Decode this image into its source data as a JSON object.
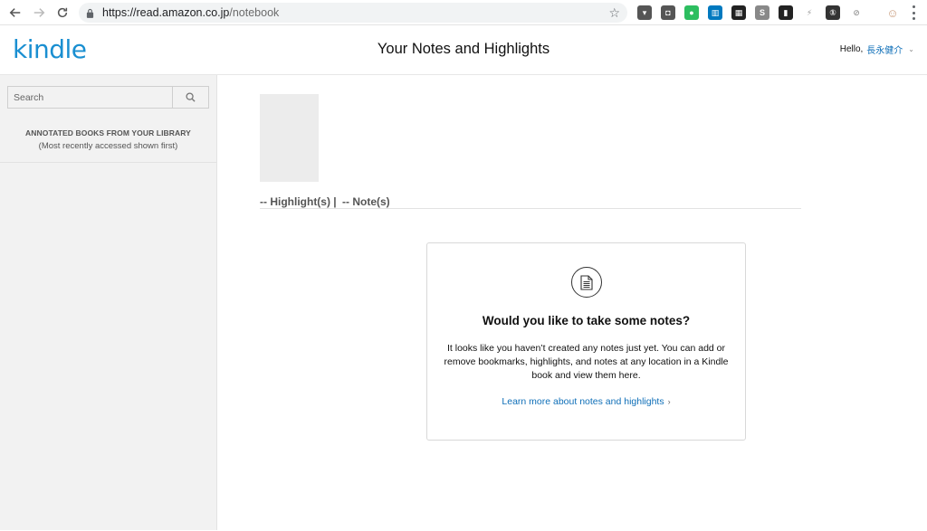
{
  "browser": {
    "url_host": "https://read.amazon.co.jp",
    "url_path": "/notebook",
    "extensions": [
      {
        "name": "pocket-icon",
        "color": "#555555",
        "glyph": "▾"
      },
      {
        "name": "shield-extension-icon",
        "color": "#555555",
        "glyph": "◘"
      },
      {
        "name": "evernote-icon",
        "color": "#2dbe60",
        "glyph": "●"
      },
      {
        "name": "trello-icon",
        "color": "#0079bf",
        "glyph": "▥"
      },
      {
        "name": "calendar-extension-icon",
        "color": "#222222",
        "glyph": "▦"
      },
      {
        "name": "s-extension-icon",
        "color": "#888888",
        "glyph": "S"
      },
      {
        "name": "bookmark-extension-icon",
        "color": "#222222",
        "glyph": "▮"
      },
      {
        "name": "lightning-icon",
        "color": "#999999",
        "glyph": "⚡"
      },
      {
        "name": "1password-icon",
        "color": "#333333",
        "glyph": "①"
      },
      {
        "name": "privacy-extension-icon",
        "color": "#999999",
        "glyph": "⊘"
      },
      {
        "name": "profile-avatar-icon",
        "color": "#c89b7b",
        "glyph": "☺"
      }
    ]
  },
  "header": {
    "logo": "kindle",
    "title": "Your Notes and Highlights",
    "greeting": "Hello,",
    "user_name": "長永健介"
  },
  "sidebar": {
    "search_placeholder": "Search",
    "library_title": "ANNOTATED BOOKS FROM YOUR LIBRARY",
    "library_subtitle": "(Most recently accessed shown first)"
  },
  "book": {
    "highlights_label": "-- Highlight(s) |",
    "notes_label": "-- Note(s)"
  },
  "empty_state": {
    "title": "Would you like to take some notes?",
    "body": "It looks like you haven’t created any notes just yet. You can add or remove bookmarks, highlights, and notes at any location in a Kindle book and view them here.",
    "link": "Learn more about notes and highlights",
    "link_chevron": "›"
  }
}
